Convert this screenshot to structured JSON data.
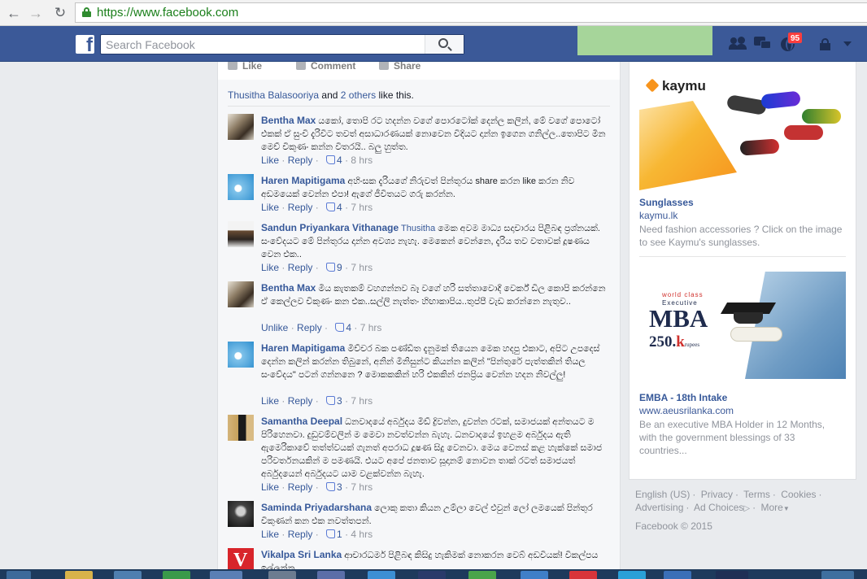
{
  "browser": {
    "url": "https://www.facebook.com"
  },
  "header": {
    "logo": "f",
    "search_placeholder": "Search Facebook",
    "notifications_count": "95"
  },
  "post_actions": {
    "like": "Like",
    "comment": "Comment",
    "share": "Share"
  },
  "likes_summary": {
    "name": "Thusitha Balasooriya",
    "and": "and",
    "others": "2 others",
    "suffix": "like this."
  },
  "comments": [
    {
      "name": "Bentha Max",
      "text": "යකෝ, තොපි රට හදන්න වගේ පොරටෝක් දෙන්ල කලින්, මේ වගේ පොටෝ එකක් ඒ සුංචි දැරිවිට තවත් අසාධාරණයක් නොවෙන විදියට දාන්න ඉගෙන ගනිල්ල..තොපිට මින මෙච් චිකුණං කන්න විතරයි.. බලු හුත්ත.",
      "action": "Like",
      "reply": "Reply",
      "likes": "4",
      "time": "8 hrs"
    },
    {
      "name": "Haren Mapitigama",
      "text": "අහිංසක දැරියගේ නිරුවත් පින්තූරය share කරන like කරන නිව අඩමයෙක් වෙන්න එපා! ඇගේ ජීවිතයට ගරු කරන්න.",
      "action": "Like",
      "reply": "Reply",
      "likes": "4",
      "time": "7 hrs"
    },
    {
      "name": "Sandun Priyankara Vithanage",
      "tag": "Thusitha",
      "text": "මෙක අවම මාධ්‍ය සදාචාරය පිළිබඳ ප්‍රශ්නයක්. සංවේදයට මේ පින්තුරය දාන්න අවශ්‍ය නැහැ. මෙකෙන් වෙන්නෙ, දැරිය තව වතාවක් දූෂණය වෙන එක..",
      "action": "Like",
      "reply": "Reply",
      "likes": "9",
      "time": "7 hrs"
    },
    {
      "name": "Bentha Max",
      "text": "මිය කැතකම් වහගන්නව බෑ වගේ හරි සත්තාවොදී වෙර්ක් ඩිල කොපි කරන්නෙ ඒ කෙල්ලව චිකුණං කන එක..සල්ලි නැත්තං හිඟාකාපිය..තුප්පී වැඩ කරන්නෙ නැතුව..",
      "action": "Unlike",
      "reply": "Reply",
      "likes": "4",
      "time": "7 hrs"
    },
    {
      "name": "Haren Mapitigama",
      "text": "මිච්චර බක පණ්ඩිත දැනුමක් තියෙන මෙක හදපු එකාට, අපිට උපදෙස් දෙන්න කලින් කරන්න තිබුනේ, අනින් මිනිසුන්ට කියන්න කලින් \"පින්තුරේ පැත්තකින් තියල සංවේදය\" පටන් ගන්නනෙ ? මොකකකින් හරි එකකින් ජනප්‍රිය වෙන්න හදන නිවල්ලු!",
      "action": "Like",
      "reply": "Reply",
      "likes": "3",
      "time": "7 hrs"
    },
    {
      "name": "Samantha Deepal",
      "text": "ධනවාදයේ අර්බුදය මිඩ් ද්‍රිවන්න, දුවන්න රටක්, සමාජයක් අන්තයට ම පිරිහෙනවා. දුඩුවම්වලින් ම මෙවා නවත්වන්න බැහැ. ධනවාදයේ ඉහළම අර්බුදය ඇති ඇමෙරිකාවේ තත්ත්වයක් ගැනත් අපරාධ දූෂණ සිදු වෙනවා. මෙය වෙනස් කළ හැක්කේ සමාජ පරිවර්තනයකින් ම පමණයි. එයට අපේ ජනතාව සූදානම් නොවන තාක් රටත් සමාජයත් අර්බුදයෙන් අර්බුදයට යාම වළක්වන්න බැහැ.",
      "action": "Like",
      "reply": "Reply",
      "likes": "3",
      "time": "7 hrs"
    },
    {
      "name": "Saminda Priyadarshana",
      "text": "ලොකු කතා කියන උම්ලා වෙල් එවුන් ලෝ ලමයෙක් පින්තුර චිකුණන් කන එක නවත්තපන්.",
      "action": "Like",
      "reply": "Reply",
      "likes": "1",
      "time": "4 hrs"
    },
    {
      "name": "Vikalpa Sri Lanka",
      "text": "ආචාරධර්ම පිළිබඳ කිසිදු හැකිමක් නොකරන වෙබ් අඩවියක්! විකල්පය ඉල්ලන්න..",
      "action": "",
      "reply": "",
      "likes": "",
      "time": ""
    }
  ],
  "ads": [
    {
      "brand": "kaymu",
      "title": "Sunglasses",
      "url": "kaymu.lk",
      "description": "Need fashion accessories ? Click on the image to see Kaymu's sunglasses."
    },
    {
      "img_line1": "world class",
      "img_line2": "Executive",
      "img_line3": "MBA",
      "img_price": "250.",
      "img_price_k": "k",
      "img_price_unit": "rupees",
      "title": "EMBA - 18th Intake",
      "url": "www.aeusrilanka.com",
      "description": "Be an executive MBA Holder in 12 Months, with the government blessings of 33 countries..."
    }
  ],
  "footer": {
    "english": "English (US)",
    "privacy": "Privacy",
    "terms": "Terms",
    "cookies": "Cookies",
    "advertising": "Advertising",
    "ad_choices": "Ad Choices",
    "more": "More",
    "copyright": "Facebook © 2015"
  },
  "colors": {
    "facebook_blue": "#3b5998",
    "link": "#365899",
    "badge": "#fa3e3e"
  }
}
